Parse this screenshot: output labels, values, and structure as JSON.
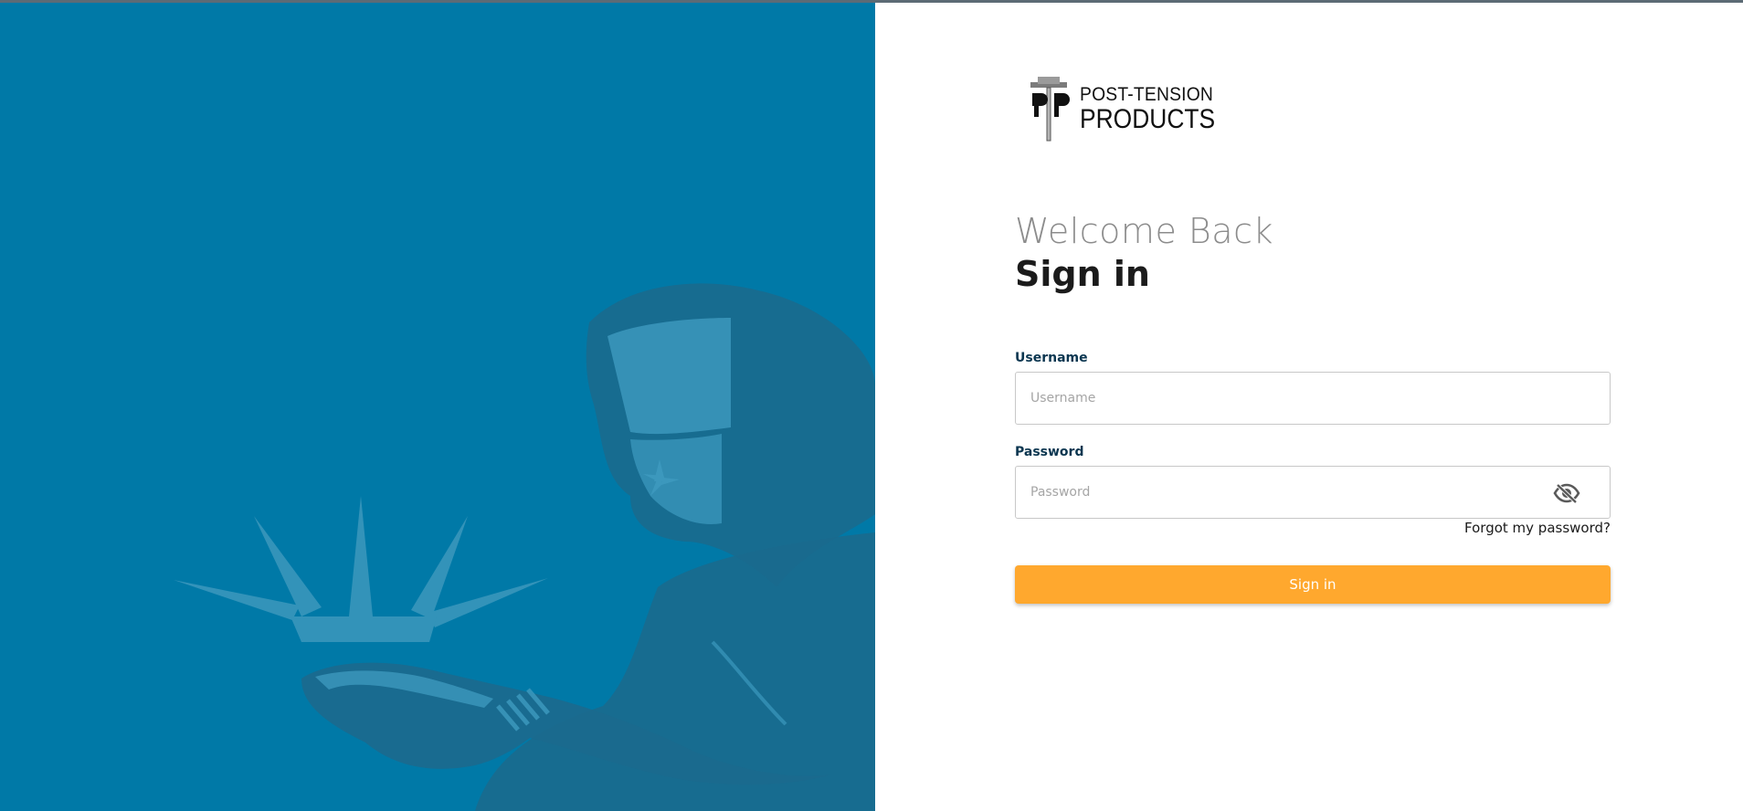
{
  "brand": {
    "line1": "POST-TENSION",
    "line2": "PRODUCTS",
    "logo_icon": "pt-anchor-logo-icon"
  },
  "hero": {
    "illustration": "welder-silhouette",
    "background_color": "#0079a7"
  },
  "heading": {
    "welcome": "Welcome Back",
    "title": "Sign in"
  },
  "form": {
    "username": {
      "label": "Username",
      "placeholder": "Username",
      "value": ""
    },
    "password": {
      "label": "Password",
      "placeholder": "Password",
      "value": "",
      "toggle_icon": "eye-slash-icon"
    },
    "forgot_link": "Forgot my password?",
    "submit_label": "Sign in"
  },
  "colors": {
    "accent": "#ffa82e",
    "label": "#0b3650",
    "hero": "#0079a7"
  }
}
